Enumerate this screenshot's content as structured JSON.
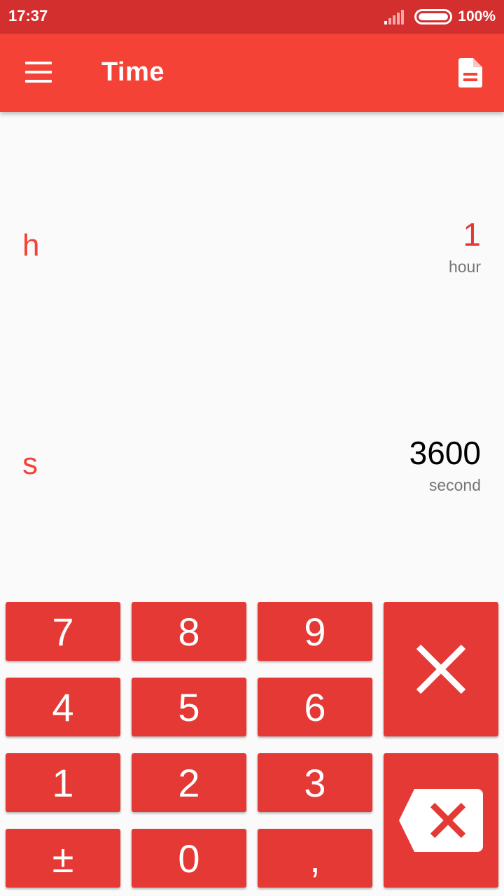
{
  "status_bar": {
    "time": "17:37",
    "battery": "100%"
  },
  "app_bar": {
    "title": "Time"
  },
  "units": [
    {
      "symbol": "h",
      "value": "1",
      "name": "hour",
      "selected": true
    },
    {
      "symbol": "s",
      "value": "3600",
      "name": "second",
      "selected": false
    }
  ],
  "keypad": {
    "k7": "7",
    "k8": "8",
    "k9": "9",
    "k4": "4",
    "k5": "5",
    "k6": "6",
    "k1": "1",
    "k2": "2",
    "k3": "3",
    "plusminus": "±",
    "k0": "0",
    "comma": ","
  },
  "icons": {
    "menu": "menu-icon",
    "document": "document-icon",
    "clear": "close-icon",
    "backspace": "backspace-icon",
    "signal": "signal-icon",
    "battery": "battery-icon"
  },
  "colors": {
    "status_bar": "#d32f2f",
    "app_bar": "#f44336",
    "key": "#e53935",
    "accent_text": "#f44336",
    "selected_value": "#e53935",
    "value": "#000000",
    "secondary": "#757575"
  }
}
